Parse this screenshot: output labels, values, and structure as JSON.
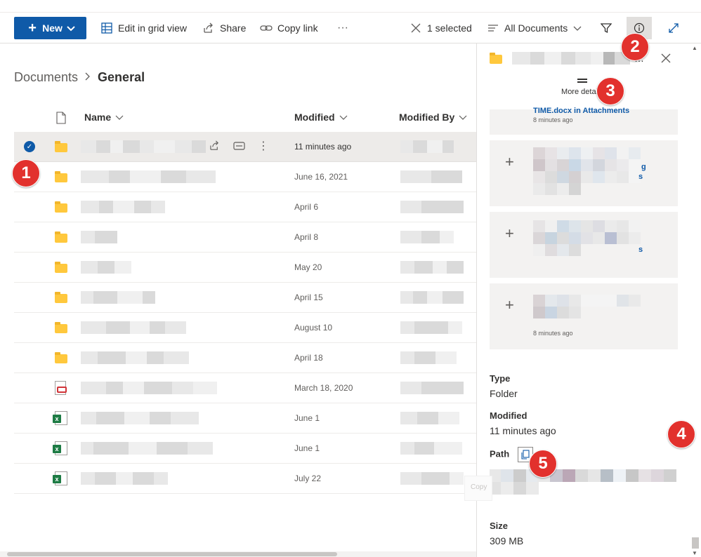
{
  "command_bar": {
    "new_label": "New",
    "edit_grid_label": "Edit in grid view",
    "share_label": "Share",
    "copy_link_label": "Copy link",
    "more_label": "···",
    "selected_label": "1 selected",
    "view_label": "All Documents"
  },
  "breadcrumb": {
    "root": "Documents",
    "current": "General"
  },
  "list": {
    "headers": {
      "name": "Name",
      "modified": "Modified",
      "modified_by": "Modified By"
    },
    "rows": [
      {
        "type": "folder",
        "modified": "11 minutes ago",
        "selected": true
      },
      {
        "type": "folder",
        "modified": "June 16, 2021"
      },
      {
        "type": "folder",
        "modified": "April 6"
      },
      {
        "type": "folder",
        "modified": "April 8"
      },
      {
        "type": "folder",
        "modified": "May 20"
      },
      {
        "type": "folder",
        "modified": "April 15"
      },
      {
        "type": "folder",
        "modified": "August 10"
      },
      {
        "type": "folder",
        "modified": "April 18"
      },
      {
        "type": "pdf",
        "modified": "March 18, 2020"
      },
      {
        "type": "xlsx",
        "modified": "June 1"
      },
      {
        "type": "xlsx",
        "modified": "June 1"
      },
      {
        "type": "xlsx",
        "modified": "July 22"
      }
    ]
  },
  "details_panel": {
    "more_details_label": "More details",
    "activity": [
      {
        "text": "TIME.docx in Attachments",
        "time": "8 minutes ago"
      },
      {
        "text": "g",
        "text2": "s"
      },
      {
        "text": "s"
      },
      {
        "time": "8 minutes ago"
      }
    ],
    "type_label": "Type",
    "type_value": "Folder",
    "modified_label": "Modified",
    "modified_value": "11 minutes ago",
    "path_label": "Path",
    "size_label": "Size",
    "size_value": "309 MB",
    "copy_tooltip_fragment": "Copy"
  },
  "callouts": [
    "1",
    "2",
    "3",
    "4",
    "5"
  ],
  "colors": {
    "accent": "#0f5aa8",
    "callout": "#e2312d",
    "folder": "#ffc83d",
    "excel": "#1d7b44",
    "pdf": "#d13438"
  }
}
